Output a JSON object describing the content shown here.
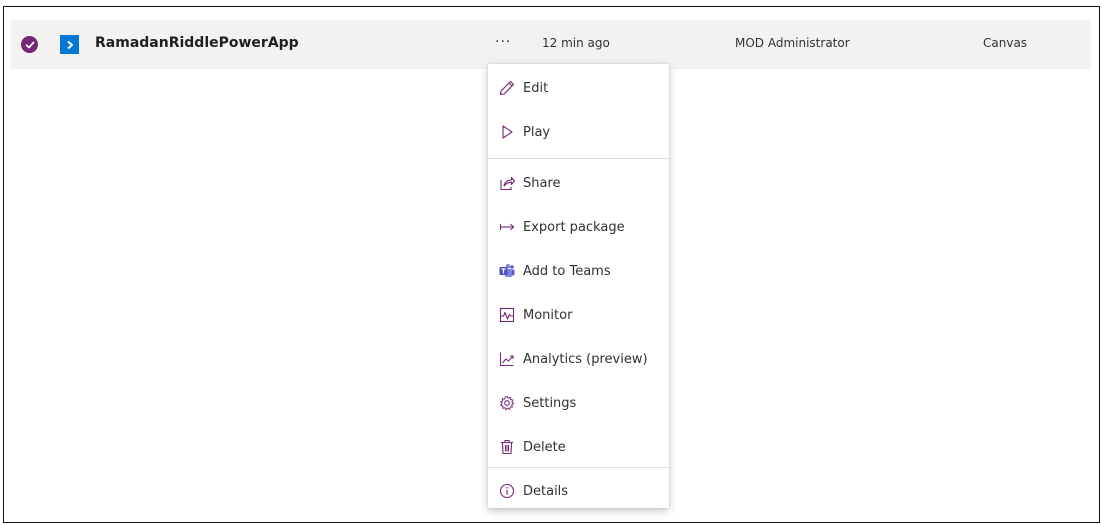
{
  "app_row": {
    "name": "RamadanRiddlePowerApp",
    "more_label": "···",
    "modified": "12 min ago",
    "owner": "MOD Administrator",
    "type": "Canvas"
  },
  "menu": {
    "items": [
      {
        "label": "Edit",
        "icon": "pencil-icon"
      },
      {
        "label": "Play",
        "icon": "play-icon"
      },
      {
        "label": "Share",
        "icon": "share-icon"
      },
      {
        "label": "Export package",
        "icon": "export-icon"
      },
      {
        "label": "Add to Teams",
        "icon": "teams-icon"
      },
      {
        "label": "Monitor",
        "icon": "monitor-icon"
      },
      {
        "label": "Analytics (preview)",
        "icon": "analytics-icon"
      },
      {
        "label": "Settings",
        "icon": "gear-icon"
      },
      {
        "label": "Delete",
        "icon": "trash-icon"
      },
      {
        "label": "Details",
        "icon": "info-icon"
      }
    ]
  },
  "colors": {
    "accent": "#742774",
    "app_icon": "#0078d4",
    "row_background": "#f3f2f1",
    "text": "#323130"
  }
}
